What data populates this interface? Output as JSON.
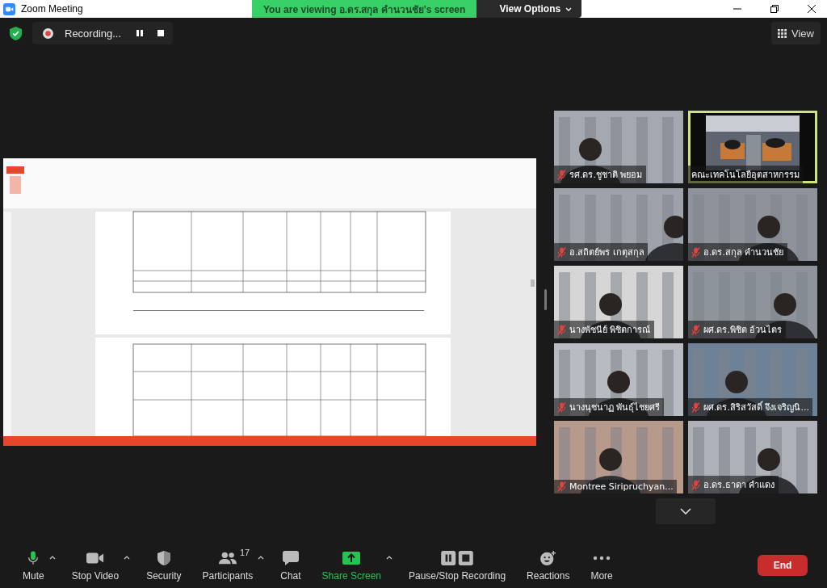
{
  "window": {
    "title": "Zoom Meeting"
  },
  "banner": {
    "text": "You are viewing อ.ดร.สกุล  คำนวนชัย's screen",
    "view_options": "View Options"
  },
  "recording": {
    "label": "Recording..."
  },
  "view_button": {
    "label": "View"
  },
  "participants": [
    {
      "name": "รศ.ดร.ชูชาติ  พยอม",
      "muted": true,
      "active": false
    },
    {
      "name": "คณะเทคโนโลยีอุตสาหกรรม",
      "muted": false,
      "active": true
    },
    {
      "name": "อ.สถิตย์พร  เกตุสกุล",
      "muted": true,
      "active": false
    },
    {
      "name": "อ.ดร.สกุล  คำนวนชัย",
      "muted": true,
      "active": false
    },
    {
      "name": "นางพัชนีย์  พิชิตการณ์",
      "muted": true,
      "active": false
    },
    {
      "name": "ผศ.ดร.พิชิต  อ้วนไตร",
      "muted": true,
      "active": false
    },
    {
      "name": "นางนุชนาฏ  พันธุ์ไชยศรี",
      "muted": true,
      "active": false
    },
    {
      "name": "ผศ.ดร.สิริสวัสดิ์ จึงเจริญนิ...",
      "muted": true,
      "active": false
    },
    {
      "name": "Montree Siripruchyan...",
      "muted": true,
      "active": false
    },
    {
      "name": "อ.ดร.ธาดา  คำแดง",
      "muted": true,
      "active": false
    }
  ],
  "toolbar": [
    {
      "label": "Mute",
      "kind": "mic",
      "caret": true
    },
    {
      "label": "Stop Video",
      "kind": "video",
      "caret": true
    },
    {
      "label": "Security",
      "kind": "security",
      "caret": false
    },
    {
      "label": "Participants",
      "kind": "participants",
      "caret": true,
      "badge": "17"
    },
    {
      "label": "Chat",
      "kind": "chat",
      "caret": false
    },
    {
      "label": "Share Screen",
      "kind": "share",
      "caret": true
    },
    {
      "label": "Pause/Stop Recording",
      "kind": "record",
      "caret": false
    },
    {
      "label": "Reactions",
      "kind": "reactions",
      "caret": false
    },
    {
      "label": "More",
      "kind": "more",
      "caret": false
    }
  ],
  "end_button": {
    "label": "End"
  }
}
